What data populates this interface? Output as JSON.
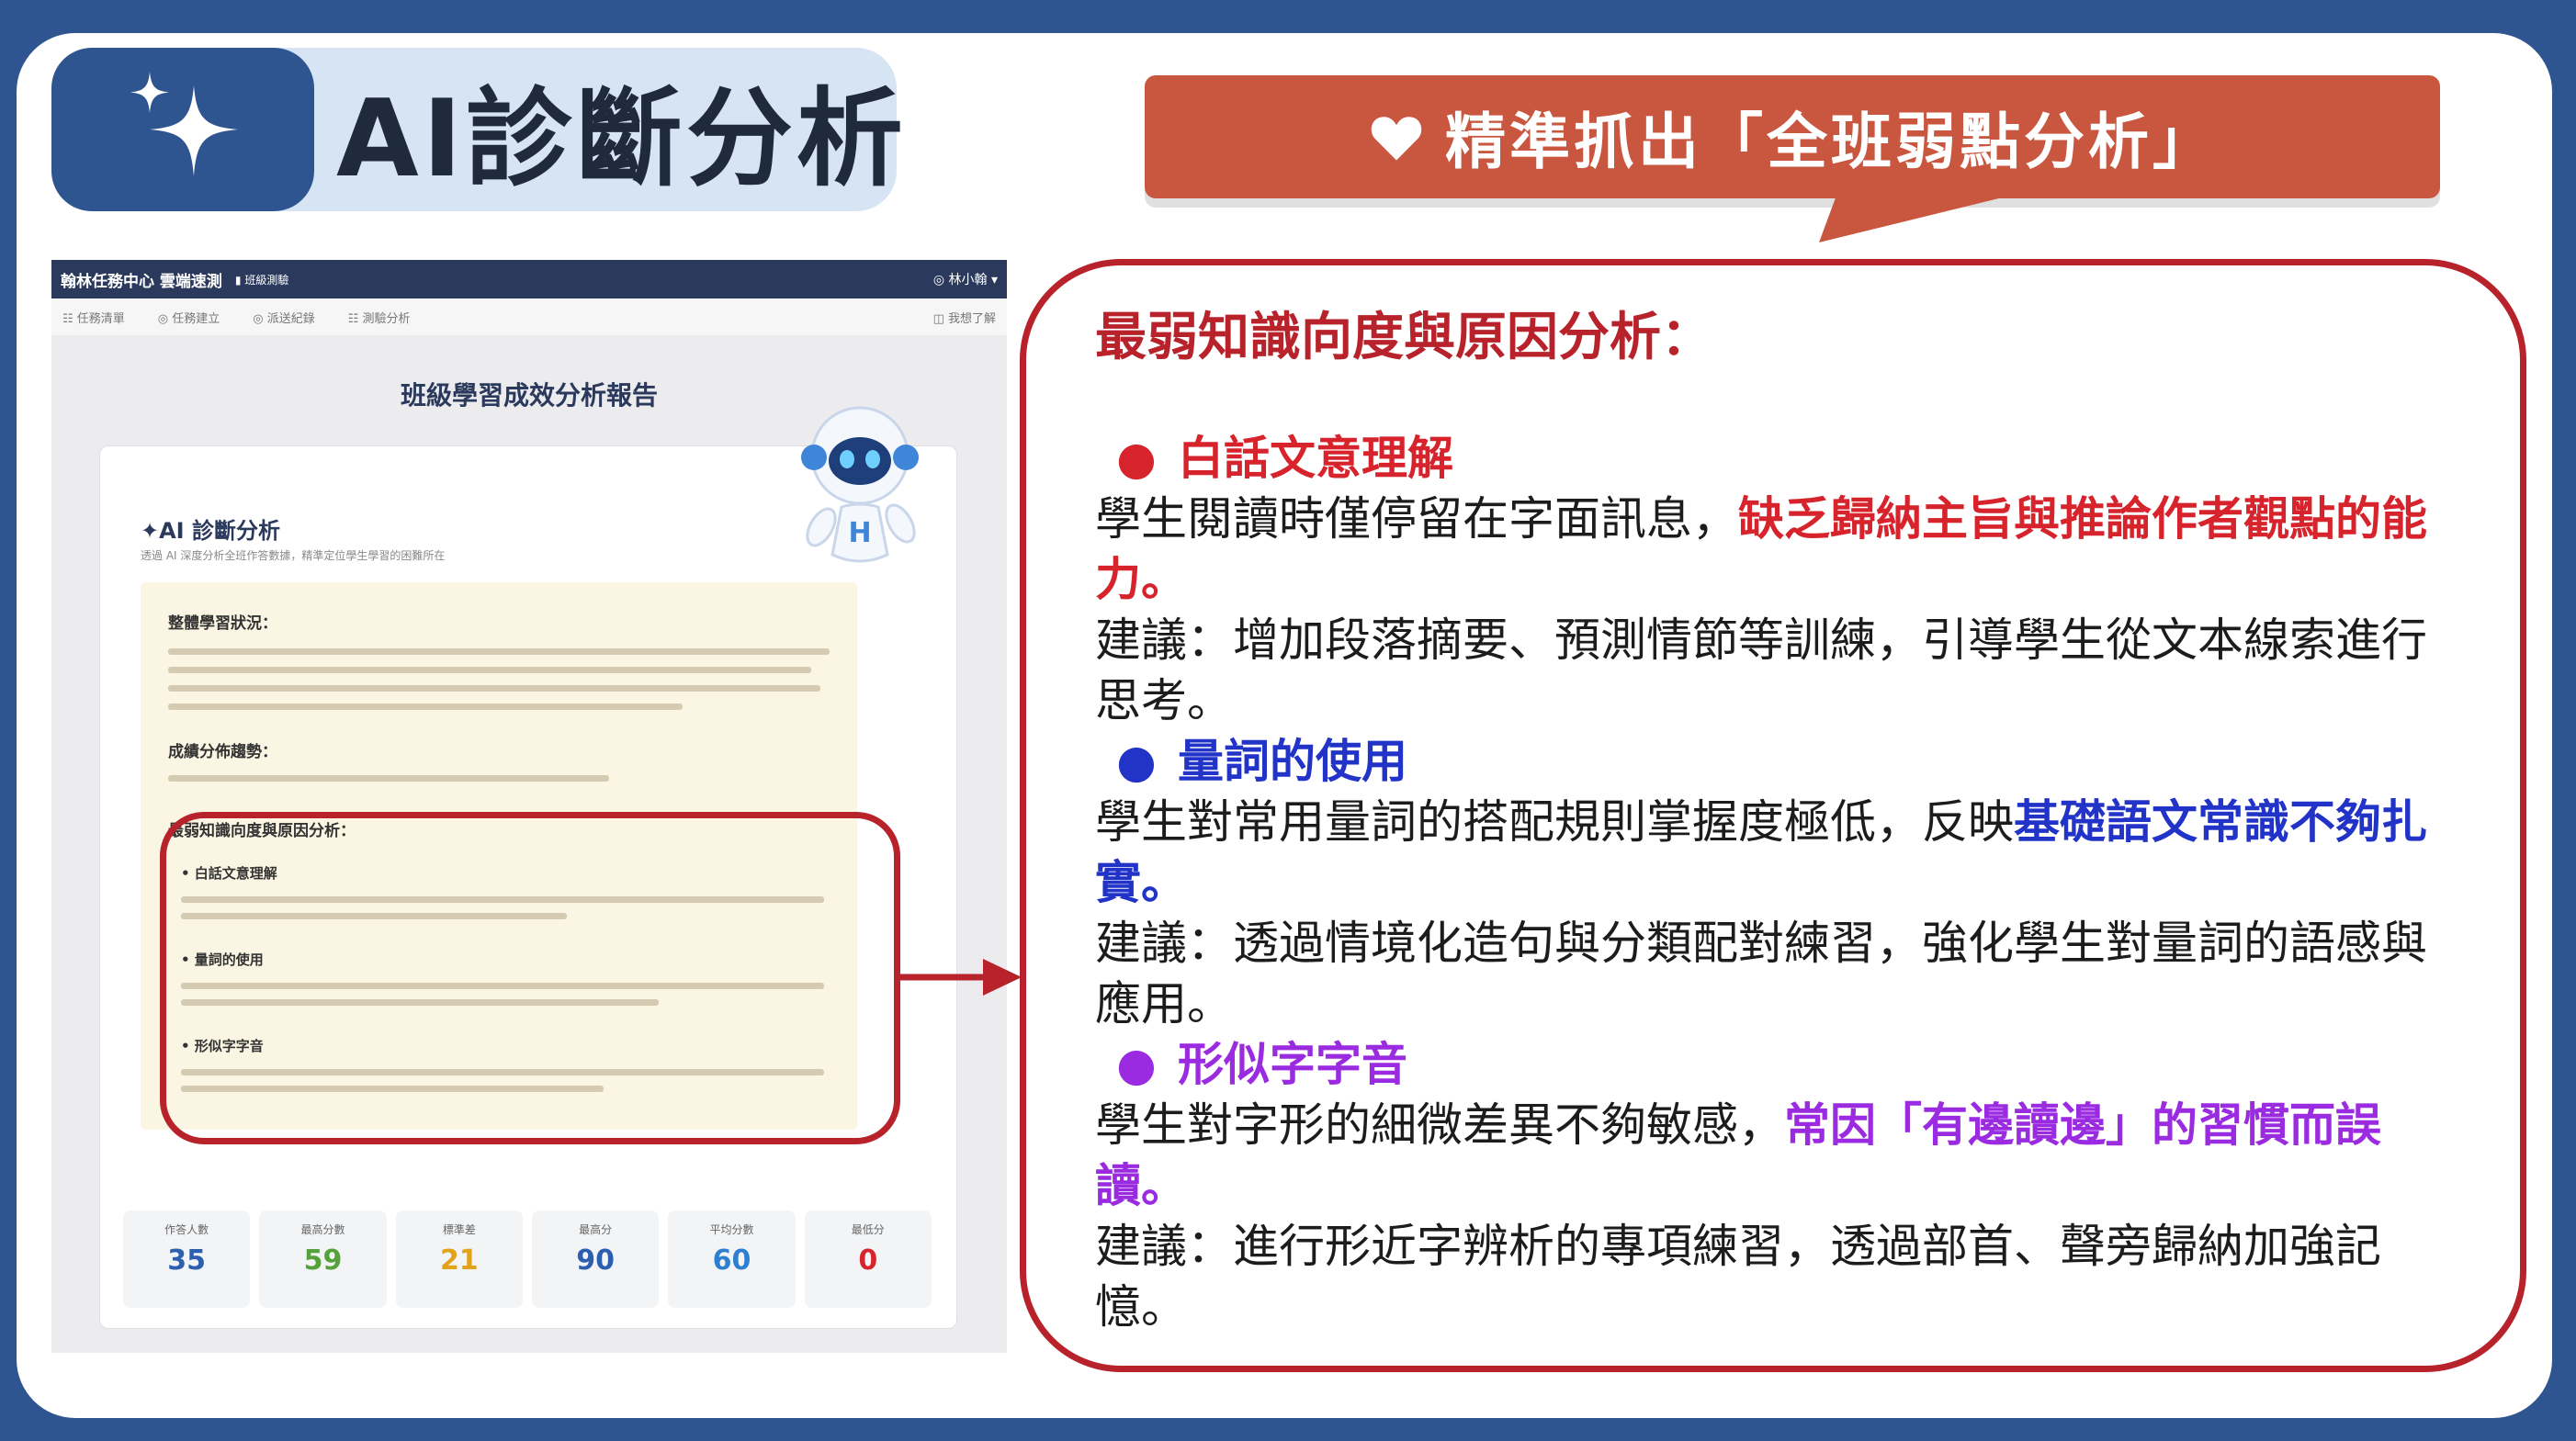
{
  "header": {
    "title": "AI診斷分析",
    "callout": "精準抓出「全班弱點分析」"
  },
  "screenshot": {
    "app_title": "翰林任務中心 雲端速測",
    "app_tag": "▮ 班級測驗",
    "user": "◎ 林小翰 ▾",
    "nav": [
      "☷ 任務清單",
      "◎ 任務建立",
      "◎ 派送紀錄",
      "☷ 測驗分析"
    ],
    "nav_right": "◫ 我想了解",
    "report_title": "班級學習成效分析報告",
    "ai_title": "✦AI 診斷分析",
    "ai_subtitle": "透過 AI 深度分析全班作答數據，精準定位學生學習的困難所在",
    "sections": [
      "整體學習狀況：",
      "成績分佈趨勢：",
      "最弱知識向度與原因分析："
    ],
    "items": [
      "• 白話文意理解",
      "• 量詞的使用",
      "• 形似字字音"
    ],
    "stats": [
      {
        "label": "作答人數",
        "value": "35",
        "color": "#2d5fb0"
      },
      {
        "label": "最高分數",
        "value": "59",
        "color": "#56a23a"
      },
      {
        "label": "標準差",
        "value": "21",
        "color": "#e2a21a"
      },
      {
        "label": "最高分",
        "value": "90",
        "color": "#2d5fb0"
      },
      {
        "label": "平均分數",
        "value": "60",
        "color": "#2d7fd0"
      },
      {
        "label": "最低分",
        "value": "0",
        "color": "#d6232c"
      }
    ]
  },
  "detail": {
    "title": "最弱知識向度與原因分析：",
    "items": [
      {
        "bullet": "●",
        "heading": "白話文意理解",
        "color": "#d6232c",
        "desc_plain": "學生閱讀時僅停留在字面訊息，",
        "desc_emph": "缺乏歸納主旨與推論作者觀點的能力。",
        "suggestion": "建議：增加段落摘要、預測情節等訓練，引導學生從文本線索進行思考。"
      },
      {
        "bullet": "●",
        "heading": "量詞的使用",
        "color": "#2233c8",
        "desc_plain": "學生對常用量詞的搭配規則掌握度極低，反映",
        "desc_emph": "基礎語文常識不夠扎實。",
        "suggestion": "建議：透過情境化造句與分類配對練習，強化學生對量詞的語感與應用。"
      },
      {
        "bullet": "●",
        "heading": "形似字字音",
        "color": "#9a2be0",
        "desc_plain": "學生對字形的細微差異不夠敏感，",
        "desc_emph": "常因「有邊讀邊」的習慣而誤讀。",
        "suggestion": "建議：進行形近字辨析的專項練習，透過部首、聲旁歸納加強記憶。"
      }
    ]
  }
}
